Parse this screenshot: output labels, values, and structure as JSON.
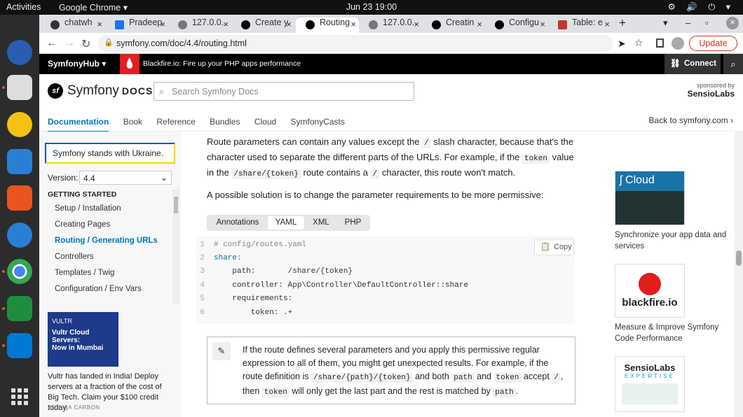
{
  "os": {
    "activities": "Activities",
    "app_name": "Google Chrome ▾",
    "clock": "Jun 23  19:00",
    "tray": "⚙ 🔊 ⏻ ▾"
  },
  "tabs": [
    {
      "label": "chatwh",
      "icon": "github-icon"
    },
    {
      "label": "Pradeep",
      "icon": "pradeep-icon"
    },
    {
      "label": "127.0.0.",
      "icon": "globe-icon"
    },
    {
      "label": "Create y",
      "icon": "symfony-icon"
    },
    {
      "label": "Routing",
      "icon": "symfony-icon",
      "active": true
    },
    {
      "label": "127.0.0.",
      "icon": "globe-icon"
    },
    {
      "label": "Creatin",
      "icon": "symfony-icon"
    },
    {
      "label": "Configu",
      "icon": "symfony-icon"
    },
    {
      "label": "Table: e",
      "icon": "table-icon"
    }
  ],
  "tab_close": "×",
  "tab_new": "+",
  "window_controls": [
    "▾",
    "–",
    "▫",
    "×"
  ],
  "address": {
    "url": "symfony.com/doc/4.4/routing.html",
    "update_label": "Update",
    "back": "←",
    "forward": "→",
    "reload": "↻"
  },
  "hub": {
    "brand": "SymfonyHub ▾",
    "ad": "Blackfire.io: Fire up your PHP apps performance",
    "connect": "Connect"
  },
  "header": {
    "logo_main": "Symfony",
    "logo_docs": "DOCS",
    "search_placeholder": "Search Symfony Docs",
    "sponsored_by": "sponsored by",
    "sponsor": "SensioLabs",
    "nav": [
      "Documentation",
      "Book",
      "Reference",
      "Bundles",
      "Cloud",
      "SymfonyCasts"
    ],
    "back_link": "Back to symfony.com ›"
  },
  "sidebar": {
    "ukraine": "Symfony stands with Ukraine.",
    "version_label": "Version:",
    "version_value": "4.4",
    "section": "GETTING STARTED",
    "items": [
      {
        "label": "Setup / Installation"
      },
      {
        "label": "Creating Pages"
      },
      {
        "label": "Routing / Generating URLs",
        "active": true
      },
      {
        "label": "Controllers"
      },
      {
        "label": "Templates / Twig"
      },
      {
        "label": "Configuration / Env Vars"
      }
    ],
    "ad_badge": "VULTR",
    "ad_head": "Vultr Cloud Servers:",
    "ad_sub": "Now in Mumbai",
    "ad_text": "Vultr has landed in India! Deploy servers at a fraction of the cost of Big Tech. Claim your $100 credit today.",
    "ad_via": "ADS VIA CARBON"
  },
  "content": {
    "p1_a": "Route parameters can contain any values except the",
    "p1_code1": "/",
    "p1_b": "slash character, because that's the character used to separate the different parts of the URLs. For example, if the",
    "p1_code2": "token",
    "p1_c": "value in the",
    "p1_code3": "/share/{token}",
    "p1_d": "route contains a",
    "p1_code4": "/",
    "p1_e": "character, this route won't match.",
    "p2": "A possible solution is to change the parameter requirements to be more permissive:",
    "code_tabs": [
      "Annotations",
      "YAML",
      "XML",
      "PHP"
    ],
    "copy_label": "Copy",
    "code_lines": [
      {
        "n": "1",
        "text": "# config/routes.yaml"
      },
      {
        "n": "2",
        "text": "share:"
      },
      {
        "n": "3",
        "text": "    path:       /share/{token}"
      },
      {
        "n": "4",
        "text": "    controller: App\\Controller\\DefaultController::share"
      },
      {
        "n": "5",
        "text": "    requirements:"
      },
      {
        "n": "6",
        "text": "        token: .+"
      }
    ],
    "note_a": "If the route defines several parameters and you apply this permissive regular expression to all of them, you might get unexpected results. For example, if the route definition is",
    "note_code1": "/share/{path}/{token}",
    "note_b": "and both",
    "note_code2": "path",
    "note_c": "and",
    "note_code3": "token",
    "note_d": "accept",
    "note_code4": "/",
    "note_e": ", then",
    "note_code5": "token",
    "note_f": "will only get the last part and the rest is matched by",
    "note_code6": "path",
    "note_g": "."
  },
  "right": {
    "cloud_title": "Cloud",
    "cloud_caption": "Synchronize your app data and services",
    "blackfire_title": "blackfire.io",
    "blackfire_caption": "Measure & Improve Symfony Code Performance",
    "sensio_title": "SensioLabs",
    "sensio_sub": "EXPERTISE"
  }
}
